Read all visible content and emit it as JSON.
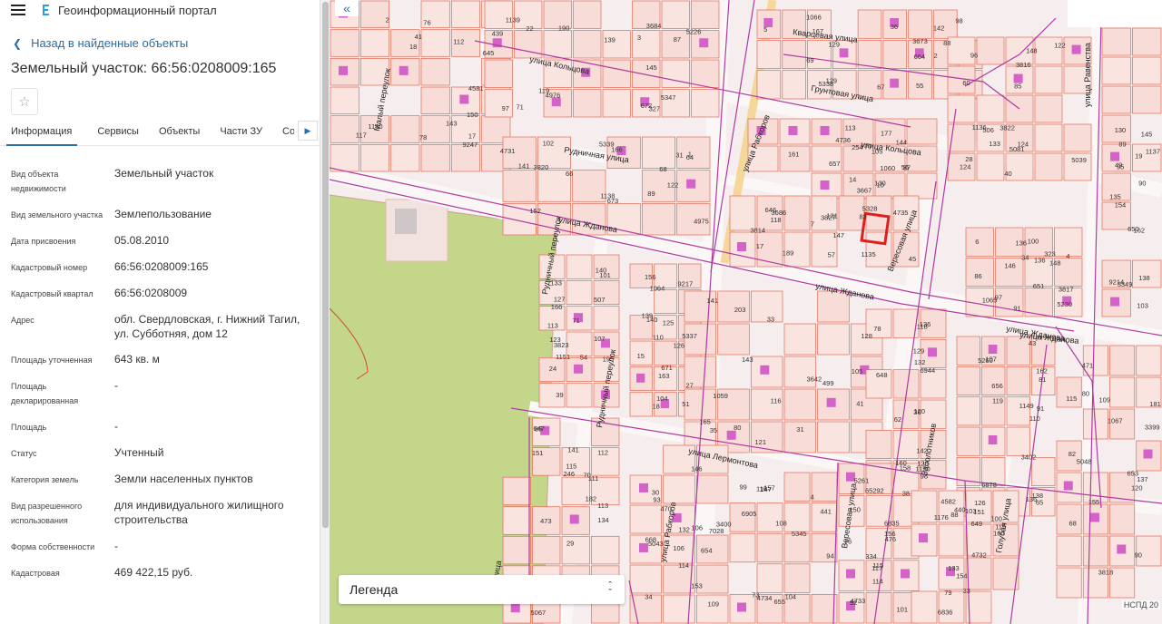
{
  "header": {
    "title": "Геоинформационный портал"
  },
  "nav": {
    "back_label": "Назад в найденные объекты"
  },
  "object": {
    "title": "Земельный участок: 66:56:0208009:165"
  },
  "tabs": [
    "Информация",
    "Сервисы",
    "Объекты",
    "Части ЗУ",
    "Состав"
  ],
  "rows": [
    {
      "key": "Вид объекта недвижимости",
      "value": "Земельный участок"
    },
    {
      "key": "Вид земельного участка",
      "value": "Землепользование"
    },
    {
      "key": "Дата присвоения",
      "value": "05.08.2010"
    },
    {
      "key": "Кадастровый номер",
      "value": "66:56:0208009:165"
    },
    {
      "key": "Кадастровый квартал",
      "value": "66:56:0208009"
    },
    {
      "key": "Адрес",
      "value": "обл. Свердловская, г. Нижний Тагил, ул. Субботняя, дом 12"
    },
    {
      "key": "Площадь уточненная",
      "value": "643 кв. м"
    },
    {
      "key": "Площадь декларированная",
      "value": "-"
    },
    {
      "key": "Площадь",
      "value": "-"
    },
    {
      "key": "Статус",
      "value": "Учтенный"
    },
    {
      "key": "Категория земель",
      "value": "Земли населенных пунктов"
    },
    {
      "key": "Вид разрешенного использования",
      "value": "для индивидуального жилищного строительства"
    },
    {
      "key": "Форма собственности",
      "value": "-"
    },
    {
      "key": "Кадастровая",
      "value": "469 422,15 руб."
    }
  ],
  "map": {
    "legend_label": "Легенда",
    "attribution": "НСПД 20",
    "streets": [
      "улица Кольцова",
      "Кварцевая улица",
      "Грунтовая улица",
      "улица Кольцова",
      "Рудничная улица",
      "улица Жданова",
      "улица Жданова",
      "улица Жданова",
      "улица Жданова",
      "улица Рабкоров",
      "улица Рабкоров",
      "Вересовая улица",
      "Вересовая улица",
      "Рудничный переулок",
      "Рудничный переулок",
      "Малый переулок",
      "улица Лермонтова",
      "Заболотников",
      "Голубая улица",
      "улица Равенства",
      "ная улица"
    ],
    "parcels": [
      "1140",
      "1139",
      "1138",
      "1066",
      "1060",
      "1135",
      "1136",
      "1065",
      "1137",
      "1064",
      "1151",
      "1059",
      "1150",
      "1149",
      "1067",
      "85",
      "93",
      "94",
      "92",
      "103",
      "76",
      "22",
      "31",
      "98",
      "105",
      "3686",
      "122",
      "136",
      "138",
      "139",
      "140",
      "141",
      "142",
      "91",
      "90",
      "113",
      "106",
      "104",
      "101",
      "100",
      "112",
      "97",
      "89",
      "88",
      "87",
      "7",
      "124",
      "6",
      "130",
      "126",
      "123",
      "121",
      "120",
      "110",
      "109",
      "111",
      "132",
      "4",
      "115",
      "133",
      "143",
      "145",
      "152",
      "5",
      "161",
      "3827",
      "3822",
      "148",
      "154",
      "156",
      "3823",
      "3642",
      "129",
      "136",
      "3818",
      "141",
      "146",
      "147",
      "150",
      "151",
      "2",
      "3684",
      "3820",
      "3673",
      "3667",
      "3814",
      "3816",
      "3817",
      "162",
      "163",
      "166",
      "165",
      "160",
      "3402",
      "3399",
      "3401",
      "3400",
      "47",
      "38",
      "33",
      "18",
      "4976",
      "4975",
      "55",
      "56",
      "57",
      "60",
      "4",
      "5349",
      "5337",
      "39",
      "35",
      "36",
      "5260",
      "80",
      "5067",
      "5043",
      "5345",
      "5261",
      "4582",
      "4581",
      "71",
      "64",
      "69",
      "77",
      "5328",
      "85",
      "86",
      "90",
      "671",
      "507",
      "499",
      "648",
      "656",
      "653",
      "647",
      "654",
      "655",
      "652",
      "649",
      "645",
      "672",
      "673",
      "664",
      "657",
      "646",
      "506",
      "651",
      "650",
      "27",
      "71",
      "80",
      "78",
      "81",
      "82",
      "29",
      "30",
      "4734",
      "4733",
      "4732",
      "4731",
      "5226",
      "5339",
      "5338",
      "4736",
      "4735",
      "96",
      "100",
      "103",
      "110",
      "113",
      "116",
      "120",
      "126",
      "5048",
      "134",
      "106",
      "108",
      "114",
      "115",
      "117",
      "119",
      "122",
      "129",
      "130",
      "131",
      "133",
      "97",
      "95",
      "104",
      "107",
      "31",
      "136",
      "138",
      "471",
      "473",
      "470",
      "441",
      "476",
      "440",
      "439",
      "3",
      "1",
      "2",
      "10",
      "17",
      "28",
      "34",
      "19",
      "18",
      "24",
      "33",
      "98",
      "107",
      "137",
      "246",
      "668",
      "6905",
      "334",
      "160",
      "9247",
      "327",
      "166",
      "167",
      "177",
      "189",
      "40",
      "323",
      "9214",
      "9217",
      "195",
      "203",
      "6944",
      "6878",
      "181",
      "182",
      "7028",
      "6955",
      "6835",
      "6836",
      "41",
      "190",
      "68",
      "36",
      "254",
      "45",
      "5081",
      "5230",
      "49",
      "51",
      "54",
      "41",
      "62",
      "65",
      "68",
      "70",
      "34",
      "73",
      "76",
      "79",
      "78",
      "5347",
      "66",
      "67",
      "14",
      "83",
      "5039",
      "91",
      "89",
      "15",
      "101",
      "105",
      "118",
      "43",
      "115",
      "112",
      "109",
      "99",
      "92",
      "88",
      "17",
      "87",
      "102",
      "129",
      "113",
      "118",
      "124",
      "136",
      "135",
      "140",
      "133",
      "143",
      "158",
      "162",
      "155",
      "151",
      "153",
      "157",
      "156",
      "154",
      "150",
      "139",
      "141",
      "142",
      "144",
      "147",
      "148",
      "146",
      "145",
      "125",
      "127",
      "128",
      "132",
      "119",
      "120",
      "115",
      "114",
      "116",
      "117",
      "1176"
    ]
  }
}
